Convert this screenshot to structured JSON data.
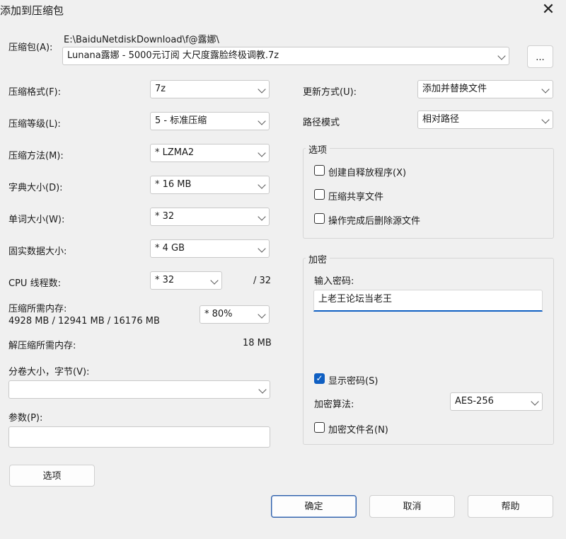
{
  "window": {
    "title": "添加到压缩包",
    "close_glyph": "✕"
  },
  "archive": {
    "label": "压缩包(A):",
    "path": "E:\\BaiduNetdiskDownload\\f@露娜\\",
    "filename": "Lunana露娜 - 5000元订阅 大尺度露脸终极调教.7z",
    "browse_label": "..."
  },
  "left": {
    "format": {
      "label": "压缩格式(F):",
      "value": "7z"
    },
    "level": {
      "label": "压缩等级(L):",
      "value": "5 - 标准压缩"
    },
    "method": {
      "label": "压缩方法(M):",
      "value": "*  LZMA2"
    },
    "dict": {
      "label": "字典大小(D):",
      "value": "*  16 MB"
    },
    "word": {
      "label": "单词大小(W):",
      "value": "*  32"
    },
    "solid": {
      "label": "固实数据大小:",
      "value": "*  4 GB"
    },
    "cpu": {
      "label": "CPU 线程数:",
      "value": "*  32",
      "max": "/ 32"
    },
    "mem_compress": {
      "label": "压缩所需内存:",
      "detail": "4928 MB / 12941 MB / 16176 MB",
      "value": "*  80%"
    },
    "mem_decompress": {
      "label": "解压缩所需内存:",
      "value": "18 MB"
    },
    "volume": {
      "label": "分卷大小，字节(V):",
      "value": ""
    },
    "params": {
      "label": "参数(P):",
      "value": ""
    },
    "options_button": "选项"
  },
  "right": {
    "update": {
      "label": "更新方式(U):",
      "value": "添加并替换文件"
    },
    "path_mode": {
      "label": "路径模式",
      "value": "相对路径"
    },
    "options_group": {
      "title": "选项",
      "items": [
        {
          "label": "创建自释放程序(X)",
          "checked": false
        },
        {
          "label": "压缩共享文件",
          "checked": false
        },
        {
          "label": "操作完成后删除源文件",
          "checked": false
        }
      ]
    },
    "encryption": {
      "title": "加密",
      "password_label": "输入密码:",
      "password_value": "上老王论坛当老王",
      "show_password": {
        "label": "显示密码(S)",
        "checked": true
      },
      "method_label": "加密算法:",
      "method_value": "AES-256",
      "encrypt_names": {
        "label": "加密文件名(N)",
        "checked": false
      }
    }
  },
  "buttons": {
    "ok": "确定",
    "cancel": "取消",
    "help": "帮助"
  },
  "colors": {
    "accent": "#0f5fc2"
  }
}
